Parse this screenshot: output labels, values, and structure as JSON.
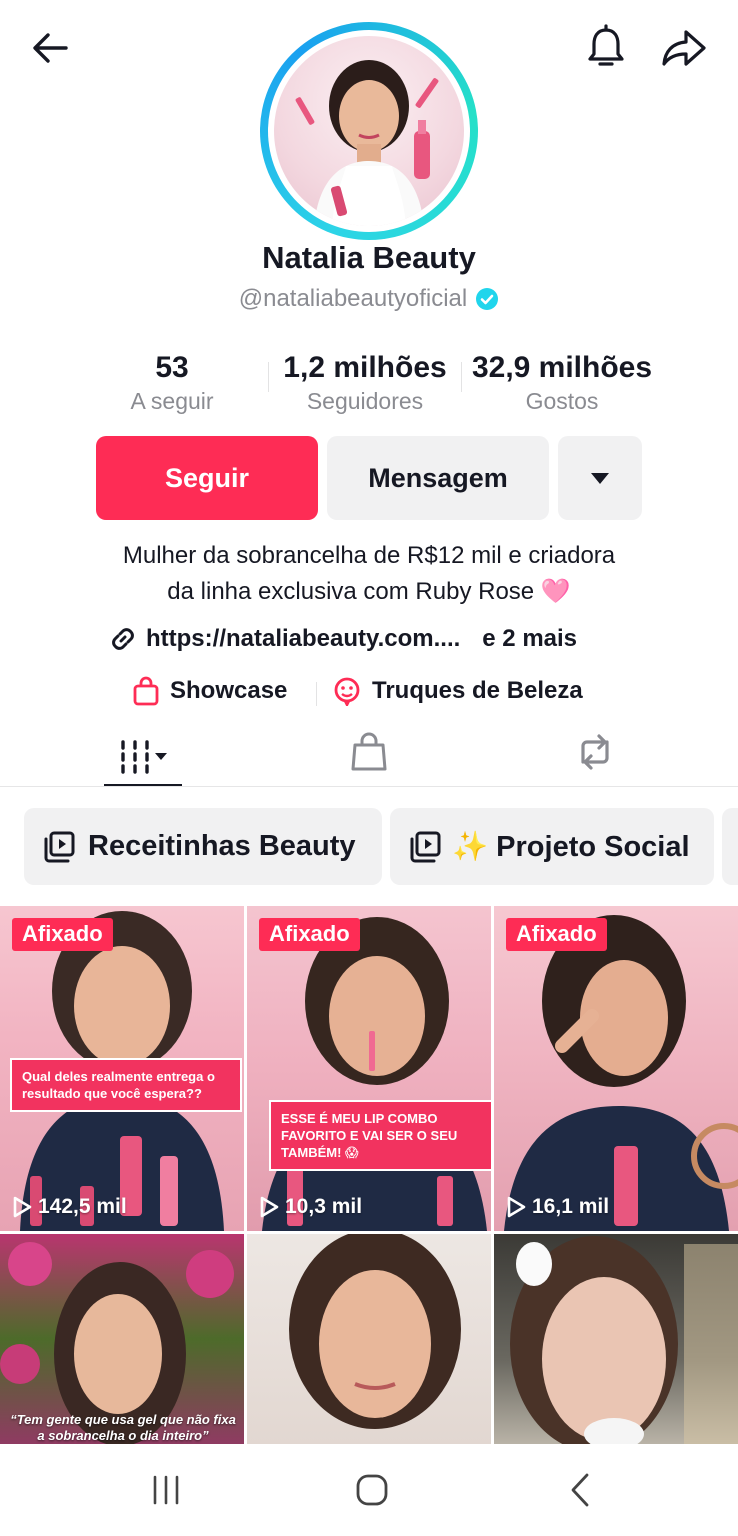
{
  "header": {
    "back_icon": "arrow-left-icon",
    "bell_icon": "bell-icon",
    "share_icon": "share-arrow-icon"
  },
  "profile": {
    "name": "Natalia Beauty",
    "handle": "@nataliabeautyoficial",
    "verified_color": "#20d5ec"
  },
  "stats": {
    "following_count": "53",
    "following_label": "A seguir",
    "followers_count": "1,2 milhões",
    "followers_label": "Seguidores",
    "likes_count": "32,9 milhões",
    "likes_label": "Gostos"
  },
  "actions": {
    "follow_label": "Seguir",
    "message_label": "Mensagem",
    "accent_color": "#fe2c55"
  },
  "bio": {
    "line1": "Mulher da sobrancelha de R$12 mil e criadora",
    "line2": "da linha exclusiva com Ruby Rose 🩷",
    "link": "https://nataliabeauty.com....",
    "link_more": "e 2 mais",
    "showcase_label": "Showcase",
    "tips_label": "Truques de Beleza"
  },
  "tabs": {
    "videos_icon": "grid-icon",
    "shop_icon": "shopping-bag-icon",
    "reposts_icon": "repost-icon"
  },
  "playlists": [
    {
      "label": "Receitinhas Beauty"
    },
    {
      "label": "✨ Projeto Social"
    }
  ],
  "videos": [
    {
      "pinned": "Afixado",
      "views": "142,5 mil",
      "caption": "Qual deles realmente entrega o resultado que você espera??"
    },
    {
      "pinned": "Afixado",
      "views": "10,3 mil",
      "caption": "ESSE É MEU LIP COMBO FAVORITO E VAI SER O SEU TAMBÉM! 😱"
    },
    {
      "pinned": "Afixado",
      "views": "16,1 mil",
      "caption": ""
    },
    {
      "pinned": "",
      "views": "",
      "caption": "“Tem gente que usa gel que não fixa a sobrancelha o dia inteiro”"
    },
    {
      "pinned": "",
      "views": "",
      "caption": ""
    },
    {
      "pinned": "",
      "views": "",
      "caption": ""
    }
  ],
  "navbar": {
    "recent_icon": "recent-apps-icon",
    "home_icon": "home-icon",
    "back_icon": "back-chevron-icon"
  }
}
